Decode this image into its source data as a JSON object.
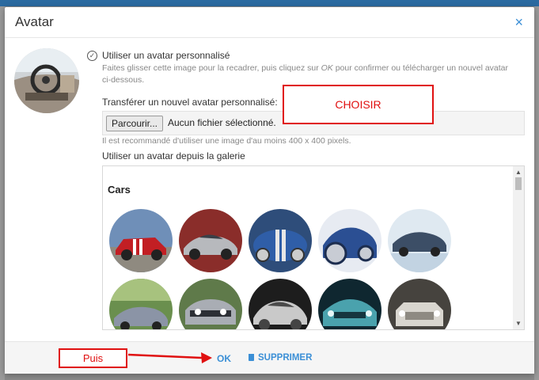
{
  "modal": {
    "title": "Avatar",
    "close_glyph": "×"
  },
  "option": {
    "label": "Utiliser un avatar personnalisé",
    "hint_line1_a": "Faites glisser cette image pour la recadrer, puis cliquez sur ",
    "hint_line1_ok": "OK",
    "hint_line1_b": " pour confirmer ou télécharger un nouvel avatar",
    "hint_line2": "ci-dessous."
  },
  "upload": {
    "label": "Transférer un nouvel avatar personnalisé:",
    "browse_label": "Parcourir...",
    "no_file": "Aucun fichier sélectionné.",
    "recommendation": "Il est recommandé d'utiliser une image d'au moins 400 x 400 pixels."
  },
  "gallery": {
    "label": "Utiliser un avatar depuis la galerie",
    "category": "Cars",
    "thumb_count": 10
  },
  "footer": {
    "ok_label": "OK",
    "delete_label": "SUPPRIMER"
  },
  "annotations": {
    "choisir": "CHOISIR",
    "puis": "Puis"
  },
  "icons": {
    "close": "close-icon",
    "check": "check-circle-icon",
    "trash": "trash-icon"
  },
  "colors": {
    "accent": "#3b8fd6",
    "annotation": "#e01010",
    "topbar": "#2b6aa0"
  }
}
